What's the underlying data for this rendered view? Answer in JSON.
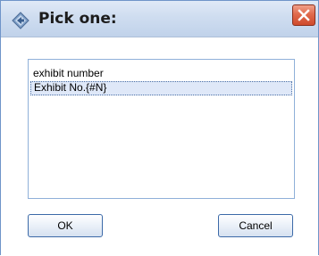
{
  "window": {
    "title": "Pick one:",
    "title_icon": "diamond-arrow-icon",
    "close_icon": "close-icon"
  },
  "list": {
    "items": [
      {
        "label": "exhibit number",
        "selected": false
      },
      {
        "label": "Exhibit No.{#N}",
        "selected": true
      }
    ]
  },
  "buttons": {
    "ok_label": "OK",
    "cancel_label": "Cancel"
  },
  "colors": {
    "titlebar": "#cfddf0",
    "close_button": "#e06a4c",
    "list_border": "#8fb0d9",
    "selection": "#dfe8f8",
    "button_border": "#3c6aa8"
  }
}
